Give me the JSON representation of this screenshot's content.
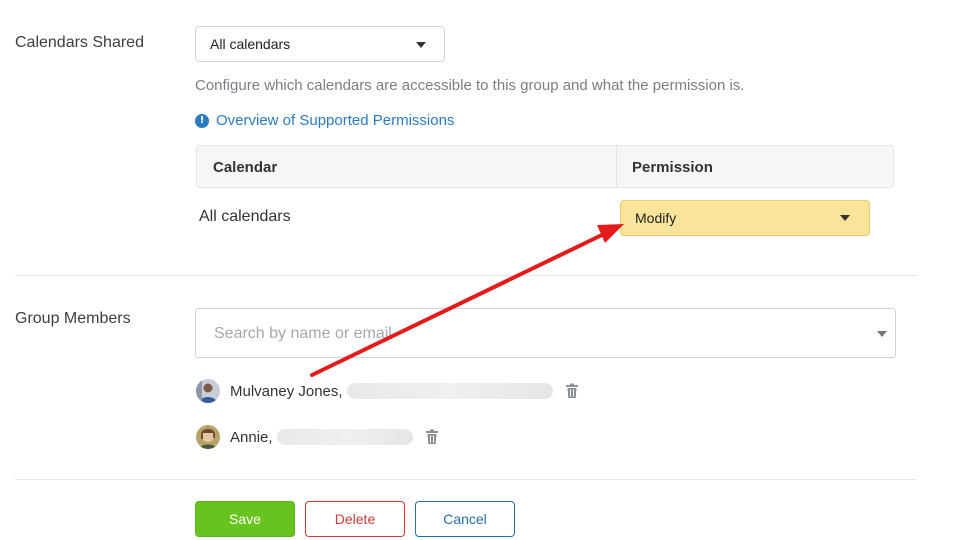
{
  "calendars_shared": {
    "label": "Calendars Shared",
    "select_value": "All calendars",
    "help_text": "Configure which calendars are accessible to this group and what the permission is.",
    "overview_link": "Overview of Supported Permissions"
  },
  "permissions_table": {
    "headers": [
      "Calendar",
      "Permission"
    ],
    "rows": [
      {
        "calendar": "All calendars",
        "permission": "Modify"
      }
    ]
  },
  "group_members": {
    "label": "Group Members",
    "search_placeholder": "Search by name or email",
    "members": [
      {
        "name": "Mulvaney Jones,"
      },
      {
        "name": "Annie,"
      }
    ]
  },
  "actions": {
    "save": "Save",
    "delete": "Delete",
    "cancel": "Cancel"
  },
  "colors": {
    "accent_link": "#2b7bbf",
    "permission_highlight": "#f8e59a",
    "save_button": "#69c31e",
    "delete_button": "#d03a3a",
    "annotation_arrow": "#e31b1b"
  }
}
